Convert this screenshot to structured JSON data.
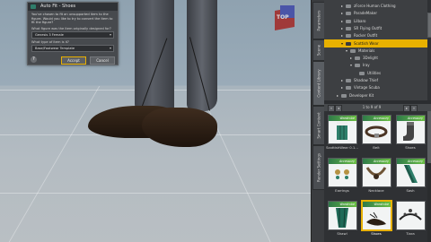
{
  "dialog": {
    "title": "Auto Fit - Shoes",
    "message": "You've chosen to fit an unsupported item to the figure. Would you like to try to convert the item to fit the figure?",
    "q1": "What figure was the item originally designed for?",
    "q1_value": "Genesis 3 Female",
    "q2": "What type of item is it?",
    "q2_value": "Base/Footwear Template",
    "help": "?",
    "accept": "Accept",
    "cancel": "Cancel"
  },
  "viewport": {
    "cube_label": "TOP"
  },
  "side_tabs": [
    "Parameters",
    "Scene",
    "Content Library",
    "Smart Content",
    "Render Settings"
  ],
  "tree": [
    {
      "label": "zForce Human Clothing",
      "depth": 1,
      "arrow": "▸"
    },
    {
      "label": "ParadeMaker",
      "depth": 1,
      "arrow": "▸"
    },
    {
      "label": "Lilbaro",
      "depth": 1,
      "arrow": "▸"
    },
    {
      "label": "SR Flying Outfit",
      "depth": 1,
      "arrow": "▸"
    },
    {
      "label": "Rocker Outfit",
      "depth": 1,
      "arrow": "▸"
    },
    {
      "label": "Scottish Wear",
      "depth": 1,
      "arrow": "▾",
      "selected": true
    },
    {
      "label": "Materials",
      "depth": 2,
      "arrow": "▾"
    },
    {
      "label": "3Delight",
      "depth": 3,
      "arrow": "▸"
    },
    {
      "label": "Iray",
      "depth": 3,
      "arrow": "▾"
    },
    {
      "label": "Utilities",
      "depth": 4,
      "arrow": ""
    },
    {
      "label": "Shadow Thief",
      "depth": 1,
      "arrow": "▸"
    },
    {
      "label": "Vintage Scuba",
      "depth": 1,
      "arrow": "▸"
    },
    {
      "label": "Developer Kit",
      "depth": 0,
      "arrow": "▸"
    }
  ],
  "pager": {
    "label": "1 to 9 of 9",
    "prev": "◂",
    "next": "▸",
    "first": "«",
    "last": "»"
  },
  "items": [
    {
      "label": "ScottishWear 0.1...",
      "banner": "Wardrobe",
      "icon": "kilt"
    },
    {
      "label": "Belt",
      "banner": "Accessory",
      "icon": "belt"
    },
    {
      "label": "Shoes",
      "banner": "Accessory",
      "icon": "sock"
    },
    {
      "label": "Earrings",
      "banner": "Accessory",
      "icon": "earrings"
    },
    {
      "label": "Necklace",
      "banner": "Accessory",
      "icon": "necklace"
    },
    {
      "label": "Sash",
      "banner": "Accessory",
      "icon": "sash"
    },
    {
      "label": "Shawl",
      "banner": "Wardrobe",
      "icon": "shawl"
    },
    {
      "label": "Shoes",
      "banner": "Wardrobe",
      "icon": "shoes",
      "selected": true
    },
    {
      "label": "Tiara",
      "banner": "",
      "icon": "tiara"
    }
  ],
  "colors": {
    "accent": "#e8b100",
    "banner_green": "#4fa14a"
  }
}
